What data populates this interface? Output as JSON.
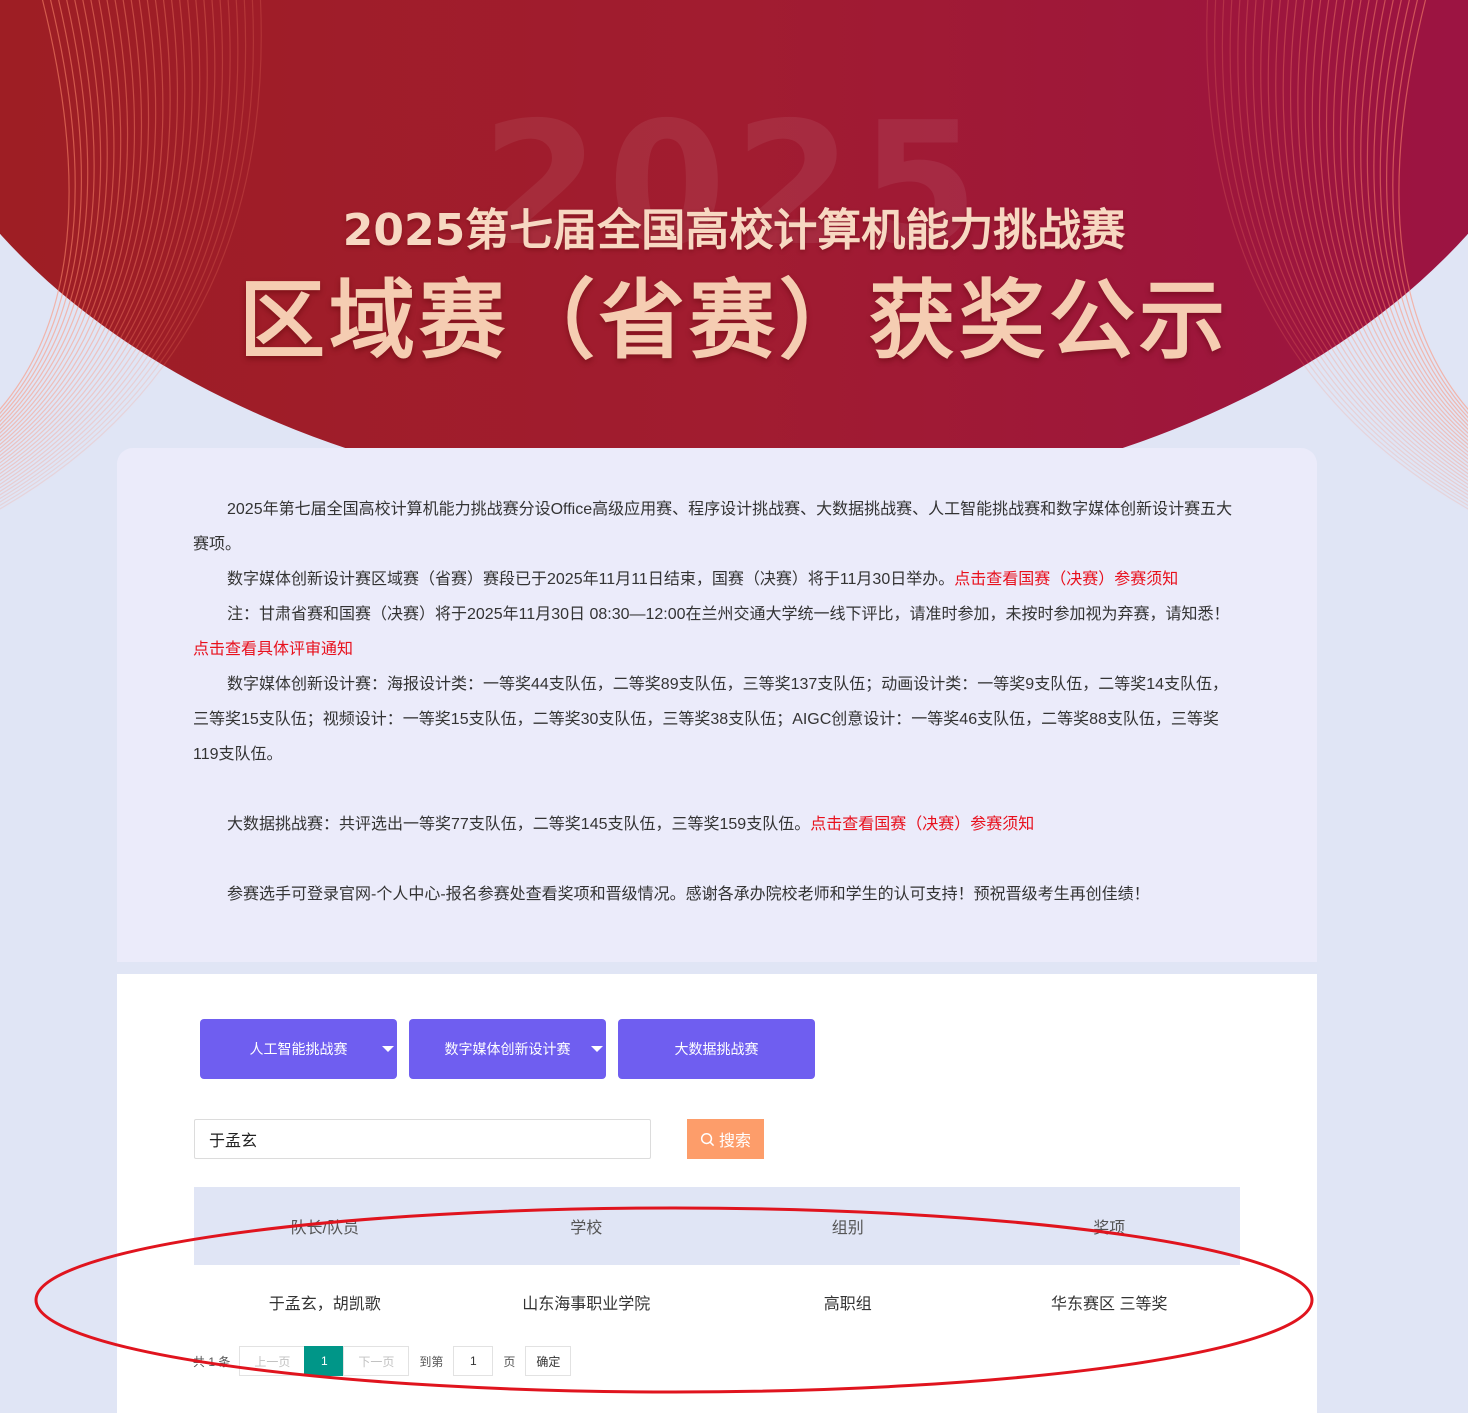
{
  "banner": {
    "watermark": "2025",
    "title_line1": "2025第七届全国高校计算机能力挑战赛",
    "title_line2": "区域赛（省赛）获奖公示"
  },
  "notice": {
    "p1": "2025年第七届全国高校计算机能力挑战赛分设Office高级应用赛、程序设计挑战赛、大数据挑战赛、人工智能挑战赛和数字媒体创新设计赛五大赛项。",
    "p2_text": "数字媒体创新设计赛区域赛（省赛）赛段已于2025年11月11日结束，国赛（决赛）将于11月30日举办。",
    "p2_link": "点击查看国赛（决赛）参赛须知",
    "p3_text": "注：甘肃省赛和国赛（决赛）将于2025年11月30日 08:30—12:00在兰州交通大学统一线下评比，请准时参加，未按时参加视为弃赛，请知悉！",
    "p3_link": "点击查看具体评审通知",
    "p4": "数字媒体创新设计赛：海报设计类：一等奖44支队伍，二等奖89支队伍，三等奖137支队伍；动画设计类：一等奖9支队伍，二等奖14支队伍，三等奖15支队伍；视频设计：一等奖15支队伍，二等奖30支队伍，三等奖38支队伍；AIGC创意设计：一等奖46支队伍，二等奖88支队伍，三等奖119支队伍。",
    "p5_text": "大数据挑战赛：共评选出一等奖77支队伍，二等奖145支队伍，三等奖159支队伍。",
    "p5_link": "点击查看国赛（决赛）参赛须知",
    "p6": "参赛选手可登录官网-个人中心-报名参赛处查看奖项和晋级情况。感谢各承办院校老师和学生的认可支持！预祝晋级考生再创佳绩！"
  },
  "tabs": [
    {
      "label": "人工智能挑战赛",
      "has_dropdown": true
    },
    {
      "label": "数字媒体创新设计赛",
      "has_dropdown": true
    },
    {
      "label": "大数据挑战赛",
      "has_dropdown": false
    }
  ],
  "search": {
    "value": "于孟玄",
    "button_label": "搜索",
    "button_icon": "search-icon"
  },
  "table": {
    "headers": [
      "队长/队员",
      "学校",
      "组别",
      "奖项"
    ],
    "rows": [
      [
        "于孟玄，胡凯歌",
        "山东海事职业学院",
        "高职组",
        "华东赛区 三等奖"
      ]
    ]
  },
  "pagination": {
    "total_text": "共 1 条",
    "prev_label": "上一页",
    "current_page": "1",
    "next_label": "下一页",
    "goto_label": "到第",
    "goto_value": "1",
    "unit_label": "页",
    "confirm_label": "确定"
  },
  "colors": {
    "banner_red": "#a11c30",
    "tab_purple": "#6f5ef0",
    "search_orange": "#fd9d6a",
    "link_red": "#e8101d",
    "page_active": "#009688",
    "highlight": "#e0141e"
  }
}
